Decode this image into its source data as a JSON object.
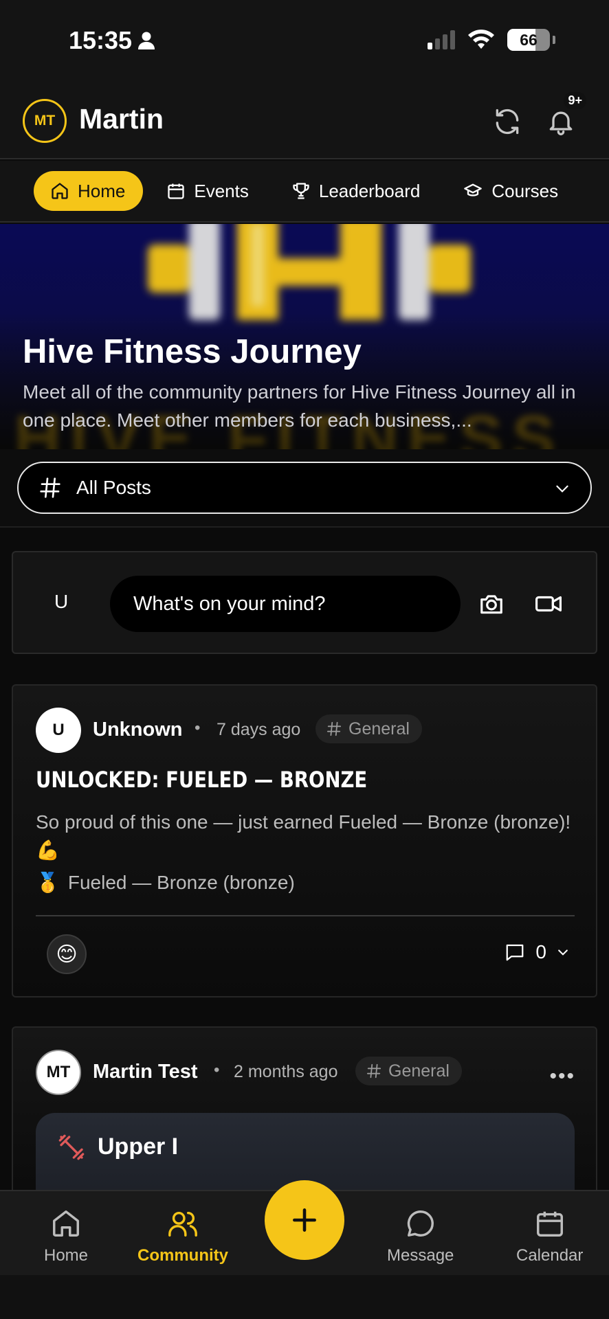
{
  "status_bar": {
    "time": "15:35",
    "battery": "66",
    "battery_level": 0.66,
    "icons": [
      "person-icon",
      "signal-icon",
      "wifi-icon",
      "battery-icon"
    ]
  },
  "header": {
    "avatar_initials": "MT",
    "user_name": "Martin",
    "notification_badge": "9+",
    "icons": [
      "refresh-icon",
      "bell-icon"
    ]
  },
  "tabs": [
    {
      "label": "Home",
      "icon": "home-icon",
      "active": true
    },
    {
      "label": "Events",
      "icon": "calendar-icon",
      "active": false
    },
    {
      "label": "Leaderboard",
      "icon": "trophy-icon",
      "active": false
    },
    {
      "label": "Courses",
      "icon": "graduation-cap-icon",
      "active": false
    }
  ],
  "hero": {
    "title": "Hive Fitness Journey",
    "description": "Meet all of the community partners for Hive Fitness Journey all in one place. Meet other members for each business,...",
    "logo_text": "HIVE FITNESS"
  },
  "filter": {
    "label": "All Posts",
    "icon": "hash-icon"
  },
  "composer": {
    "avatar_initial": "U",
    "placeholder": "What's on your mind?",
    "icons": [
      "camera-icon",
      "video-icon"
    ]
  },
  "posts": [
    {
      "avatar": "U",
      "author": "Unknown",
      "time": "7 days ago",
      "channel": "General",
      "title": "UNLOCKED: FUELED — BRONZE",
      "body": "So proud of this one — just earned Fueled — Bronze (bronze)! 💪",
      "award_emoji": "🥇",
      "award": "Fueled — Bronze (bronze)",
      "reaction": "😊",
      "comments": "0"
    },
    {
      "avatar": "MT",
      "author": "Martin Test",
      "time": "2 months ago",
      "channel": "General",
      "workout_title": "Upper I"
    }
  ],
  "bottom_nav": [
    {
      "label": "Home",
      "icon": "home-icon",
      "active": false
    },
    {
      "label": "Community",
      "icon": "users-icon",
      "active": true
    },
    {
      "label": "Message",
      "icon": "chat-bubble-icon",
      "active": false
    },
    {
      "label": "Calendar",
      "icon": "calendar-icon",
      "active": false
    }
  ],
  "colors": {
    "accent": "#f5c518",
    "background": "#0b0b0b",
    "surface": "#151515",
    "hero_bg": "#0a0a55"
  }
}
